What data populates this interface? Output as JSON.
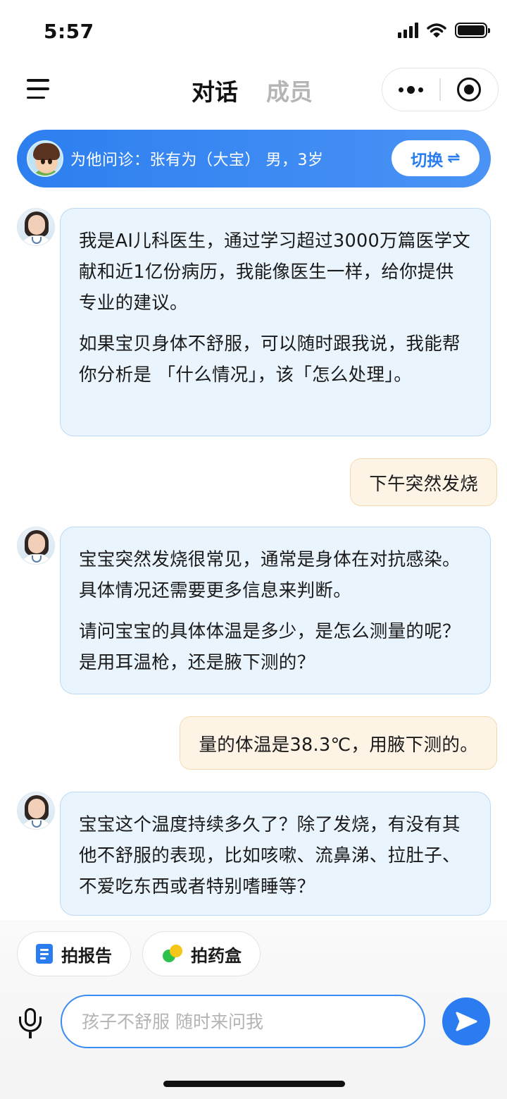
{
  "status": {
    "time": "5:57"
  },
  "header": {
    "tabs": [
      {
        "label": "对话",
        "active": true
      },
      {
        "label": "成员",
        "active": false
      }
    ]
  },
  "patient": {
    "info": "为他问诊：张有为（大宝） 男，3岁",
    "switch_label": "切换",
    "switch_icon": "⇌"
  },
  "messages": [
    {
      "role": "assistant",
      "paragraphs": [
        "我是AI儿科医生，通过学习超过3000万篇医学文献和近1亿份病历，我能像医生一样，给你提供专业的建议。",
        "如果宝贝身体不舒服，可以随时跟我说，我能帮你分析是 「什么情况」，该「怎么处理」。"
      ]
    },
    {
      "role": "user",
      "text": "下午突然发烧"
    },
    {
      "role": "assistant",
      "paragraphs": [
        "宝宝突然发烧很常见，通常是身体在对抗感染。具体情况还需要更多信息来判断。",
        "请问宝宝的具体体温是多少，是怎么测量的呢？是用耳温枪，还是腋下测的？"
      ]
    },
    {
      "role": "user",
      "text": "量的体温是38.3℃，用腋下测的。"
    },
    {
      "role": "assistant",
      "paragraphs": [
        "宝宝这个温度持续多久了？除了发烧，有没有其他不舒服的表现，比如咳嗽、流鼻涕、拉肚子、不爱吃东西或者特别嗜睡等？"
      ]
    }
  ],
  "quick_actions": [
    {
      "label": "拍报告",
      "icon": "report-icon"
    },
    {
      "label": "拍药盒",
      "icon": "pill-icon"
    }
  ],
  "composer": {
    "placeholder": "孩子不舒服 随时来问我"
  },
  "colors": {
    "accent": "#2a7cf0",
    "ai_bubble": "#eaf4fd",
    "user_bubble": "#fdf4e6"
  }
}
